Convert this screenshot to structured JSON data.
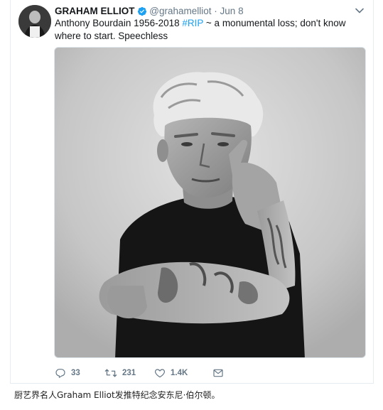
{
  "tweet": {
    "display_name": "GRAHAM ELLIOT",
    "handle": "@grahamelliot",
    "separator": "·",
    "date": "Jun 8",
    "text_before_hashtag": "Anthony Bourdain 1956-2018 ",
    "hashtag": "#RIP",
    "text_after_hashtag": " ~ a monumental loss; don't know where to start. Speechless",
    "verified": true,
    "icons": {
      "verified": "verified-badge-icon",
      "caret": "chevron-down-icon",
      "reply": "reply-icon",
      "retweet": "retweet-icon",
      "like": "heart-icon",
      "message": "envelope-icon"
    },
    "actions": {
      "replies": "33",
      "retweets": "231",
      "likes": "1.4K"
    },
    "colors": {
      "verified_blue": "#1da1f2",
      "hashtag_blue": "#1da1f2",
      "muted": "#657786"
    }
  },
  "caption": "厨艺界名人Graham Elliot发推特纪念安东尼·伯尔顿。"
}
